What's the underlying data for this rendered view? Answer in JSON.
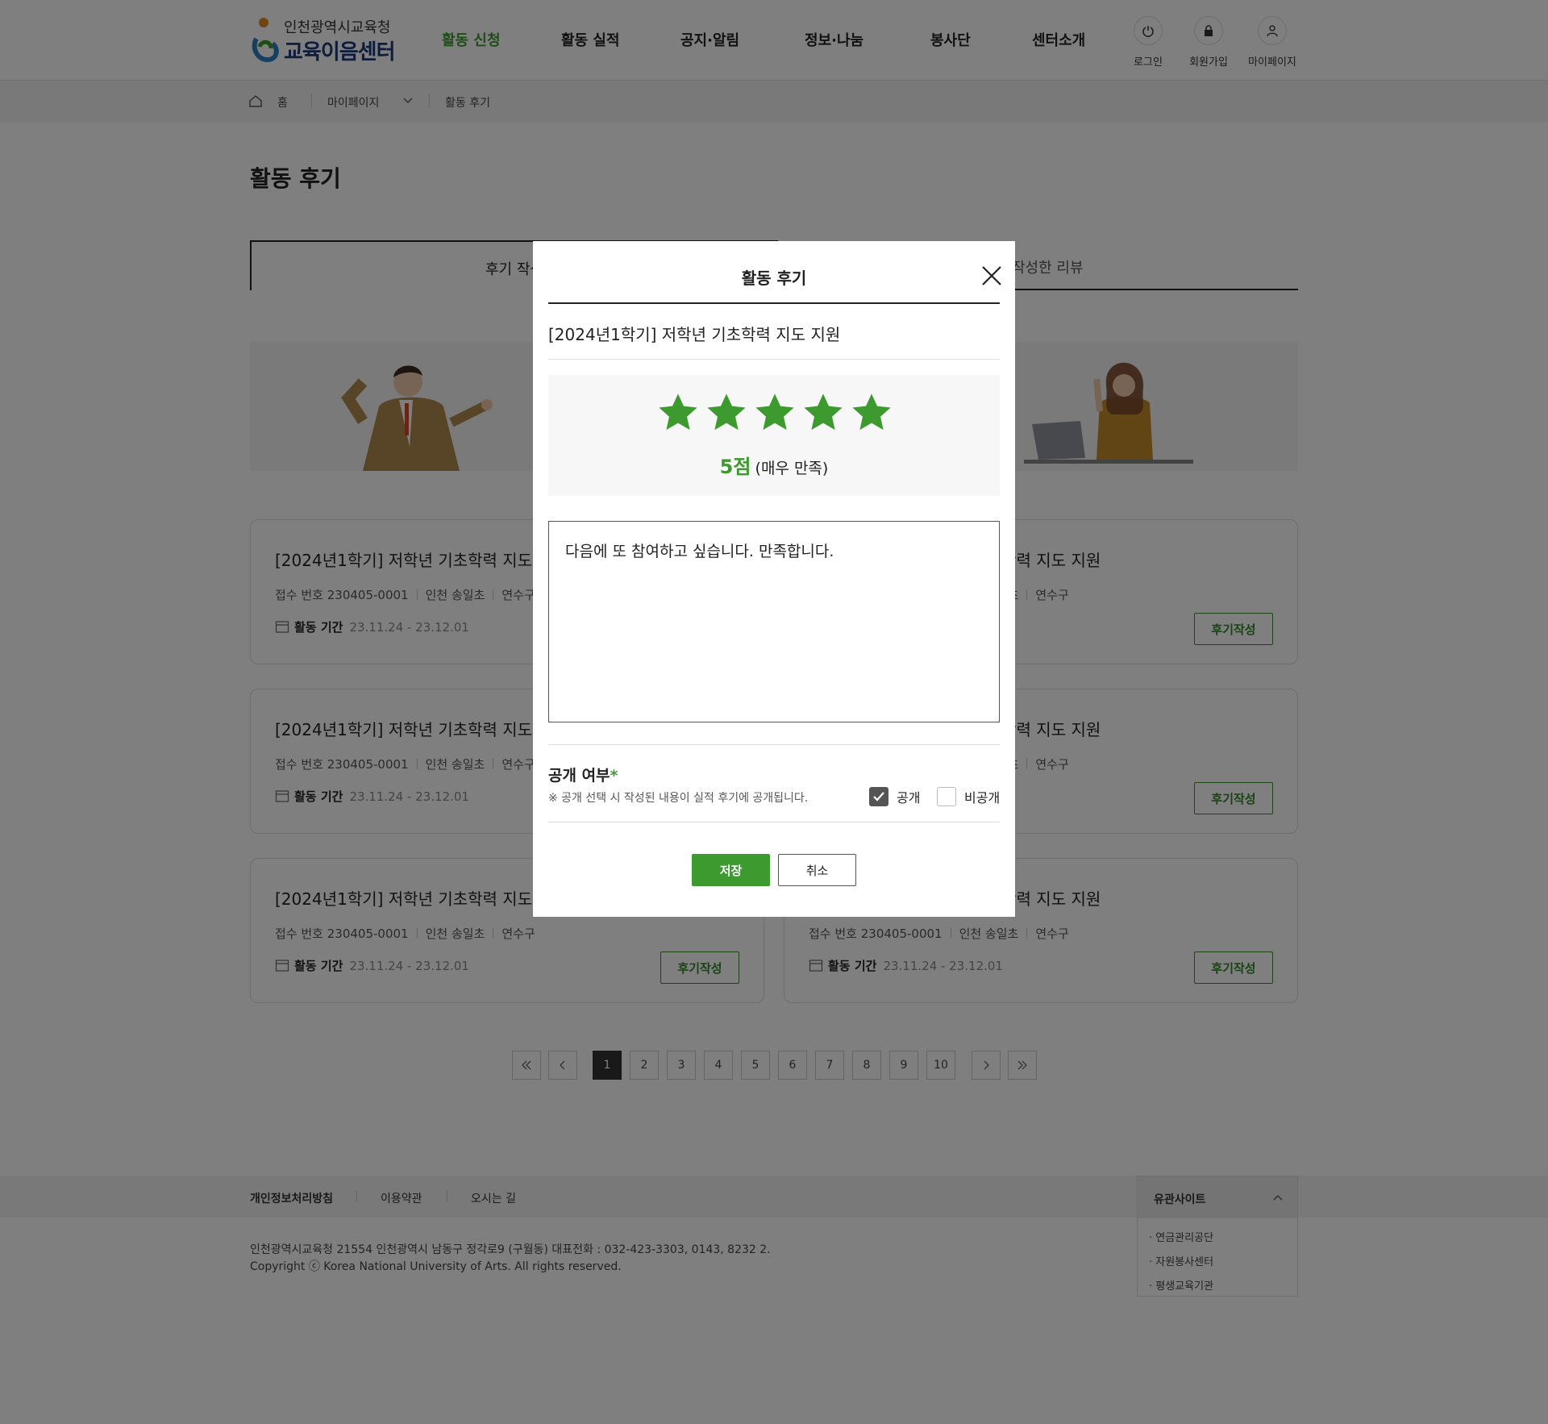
{
  "header": {
    "logo_top": "인천광역시교육청",
    "logo_main": "교육이음센터",
    "nav": [
      "활동 신청",
      "활동 실적",
      "공지·알림",
      "정보·나눔",
      "봉사단",
      "센터소개"
    ],
    "util": {
      "login": "로그인",
      "signup": "회원가입",
      "mypage": "마이페이지"
    }
  },
  "breadcrumb": {
    "home": "홈",
    "level1": "마이페이지",
    "level2": "활동 후기"
  },
  "page_title": "활동 후기",
  "tabs": {
    "write": "후기 작성",
    "written": "작성한 리뷰"
  },
  "cards": {
    "title": "[2024년1학기] 저학년 기초학력 지도 지원",
    "receipt": "접수 번호 230405-0001",
    "school": "인천 송일초",
    "district": "연수구",
    "period_label": "활동 기간",
    "period": "23.11.24 - 23.12.01",
    "button": "후기작성"
  },
  "pagination": {
    "pages": [
      "1",
      "2",
      "3",
      "4",
      "5",
      "6",
      "7",
      "8",
      "9",
      "10"
    ],
    "current": "1"
  },
  "footer": {
    "links": [
      "개인정보처리방침",
      "이용약관",
      "오시는 길"
    ],
    "address": "인천광역시교육청 21554 인천광역시 남동구 정각로9 (구월동) 대표전화 : 032-423-3303, 0143, 8232 2.",
    "copyright": "Copyright ⓒ Korea National University of Arts. All rights reserved.",
    "family_title": "유관사이트",
    "family_items": [
      "· 연금관리공단",
      "· 자원봉사센터",
      "· 평생교육기관"
    ]
  },
  "modal": {
    "title": "활동 후기",
    "activity": "[2024년1학기] 저학년 기초학력 지도 지원",
    "rating": 5,
    "rating_max": 5,
    "score_num": "5점",
    "score_text": "(매우 만족)",
    "review_text": "다음에 또 참여하고 싶습니다. 만족합니다.",
    "public_label": "공개 여부",
    "required_mark": "*",
    "public_note": "※ 공개 선택 시 작성된 내용이 실적 후기에 공개됩니다.",
    "option_public": "공개",
    "option_private": "비공개",
    "public_checked": true,
    "private_checked": false,
    "save": "저장",
    "cancel": "취소"
  },
  "colors": {
    "accent": "#3d9a2e",
    "logo_blue": "#1e3a78"
  }
}
